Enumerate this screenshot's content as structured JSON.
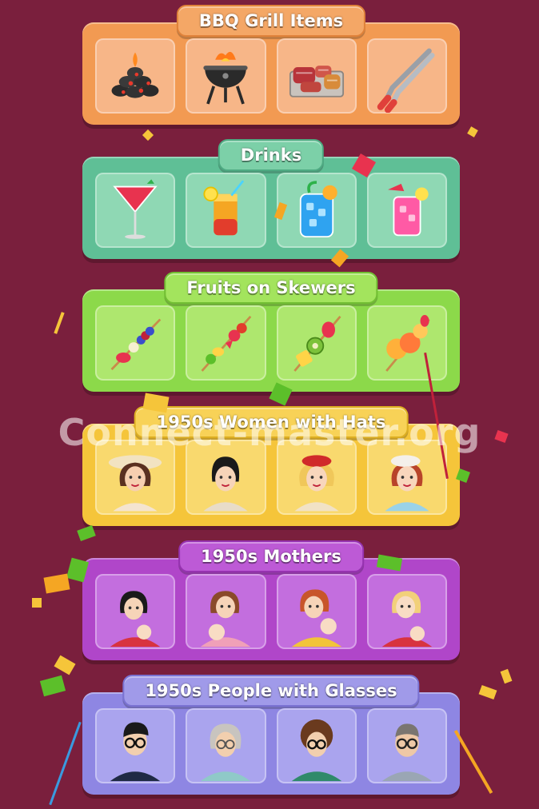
{
  "watermark": "Connect-master.org",
  "groups": [
    {
      "title": "BBQ Grill Items",
      "items": [
        "coals-icon",
        "grill-icon",
        "meat-tray-icon",
        "tongs-icon"
      ]
    },
    {
      "title": "Drinks",
      "items": [
        "cocktail-icon",
        "layered-drink-icon",
        "blue-lemonade-icon",
        "pink-drink-icon"
      ]
    },
    {
      "title": "Fruits on Skewers",
      "items": [
        "berry-skewer-icon",
        "strawberry-banana-skewer-icon",
        "kiwi-pineapple-skewer-icon",
        "peach-skewer-icon"
      ]
    },
    {
      "title": "1950s Women with Hats",
      "items": [
        "sun-hat-woman-icon",
        "black-hair-woman-icon",
        "red-beret-woman-icon",
        "white-hat-woman-icon"
      ]
    },
    {
      "title": "1950s Mothers",
      "items": [
        "mother-baby-1-icon",
        "mother-baby-2-icon",
        "mother-baby-3-icon",
        "mother-baby-4-icon"
      ]
    },
    {
      "title": "1950s People with Glasses",
      "items": [
        "young-man-glasses-icon",
        "elderly-woman-glasses-icon",
        "woman-curly-glasses-icon",
        "older-man-glasses-icon"
      ]
    }
  ],
  "colors": {
    "background": "#7a1f3d",
    "bbq": "#f29a52",
    "drinks": "#5fbf96",
    "fruits": "#8cd94a",
    "women": "#f5c53a",
    "mothers": "#b046c9",
    "glasses": "#8e86e3"
  }
}
